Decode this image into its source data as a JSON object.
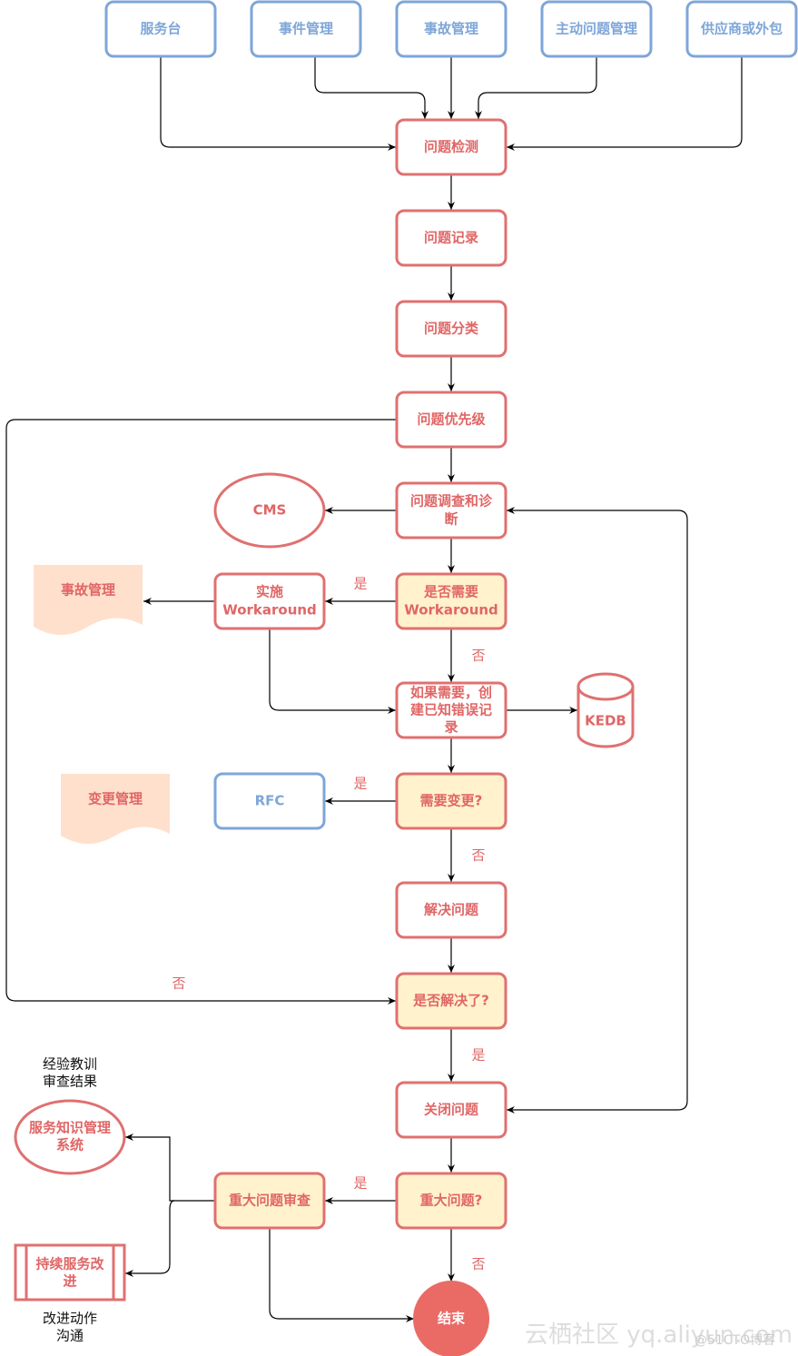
{
  "colors": {
    "blue": "#7ea6d8",
    "red": "#e07070",
    "yellow_fill": "#fff2cc",
    "doc_fill": "#ffe0cc",
    "end_fill": "#ea6b66"
  },
  "sources": [
    "服务台",
    "事件管理",
    "事故管理",
    "主动问题管理",
    "供应商或外包"
  ],
  "nodes": {
    "detect": "问题检测",
    "record": "问题记录",
    "classify": "问题分类",
    "priority": "问题优先级",
    "investigate": [
      "问题调查和诊",
      "断"
    ],
    "cms": "CMS",
    "need_workaround": [
      "是否需要",
      "Workaround"
    ],
    "apply_workaround": [
      "实施",
      "Workaround"
    ],
    "incident_doc": "事故管理",
    "known_error": [
      "如果需要，创",
      "建已知错误记",
      "录"
    ],
    "kedb": "KEDB",
    "need_change": "需要变更?",
    "rfc": "RFC",
    "change_doc": "变更管理",
    "resolve": "解决问题",
    "resolved": "是否解决了?",
    "close": "关闭问题",
    "major": "重大问题?",
    "major_review": "重大问题审查",
    "skms": [
      "服务知识管理",
      "系统"
    ],
    "csi": [
      "持续服务改",
      "进"
    ],
    "end": "结束"
  },
  "labels": {
    "yes": "是",
    "no": "否"
  },
  "notes": {
    "lessons": [
      "经验教训",
      "审查结果"
    ],
    "actions": [
      "改进动作",
      "沟通"
    ]
  },
  "watermark": {
    "main": "云栖社区 yq.aliyun.com",
    "sub": "@51CTO博客"
  }
}
